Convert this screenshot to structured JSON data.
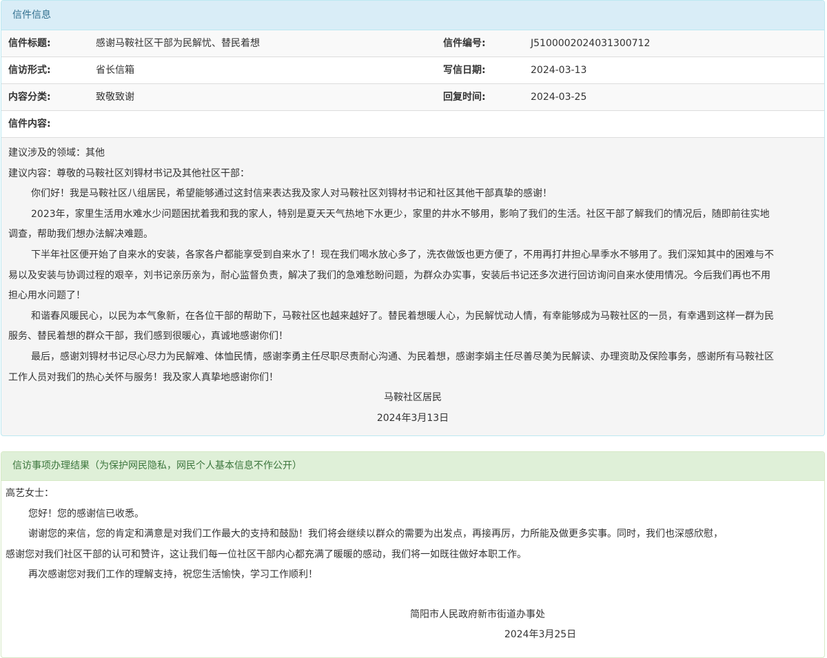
{
  "letter_panel": {
    "title": "信件信息",
    "rows": [
      {
        "label1": "信件标题:",
        "value1": "感谢马鞍社区干部为民解忧、替民着想",
        "label2": "信件编号:",
        "value2": "J5100002024031300712"
      },
      {
        "label1": "信访形式:",
        "value1": "省长信箱",
        "label2": "写信日期:",
        "value2": "2024-03-13"
      },
      {
        "label1": "内容分类:",
        "value1": "致敬致谢",
        "label2": "回复时间:",
        "value2": "2024-03-25"
      }
    ],
    "content_label": "信件内容:",
    "body": {
      "domain": "建议涉及的领域：其他",
      "salutation": "建议内容：尊敬的马鞍社区刘锝材书记及其他社区干部：",
      "lines": [
        {
          "text": "你们好！我是马鞍社区八组居民，希望能够通过这封信来表达我及家人对马鞍社区刘锝材书记和社区其他干部真挚的感谢！",
          "indent": true
        },
        {
          "text": "2023年，家里生活用水难水少问题困扰着我和我的家人，特别是夏天天气热地下水更少，家里的井水不够用，影响了我们的生活。社区干部了解我们的情况后，随即前往实地",
          "indent": true
        },
        {
          "text": "调查，帮助我们想办法解决难题。",
          "indent": false
        },
        {
          "text": "下半年社区便开始了自来水的安装，各家各户都能享受到自来水了！现在我们喝水放心多了，洗衣做饭也更方便了，不用再打井担心旱季水不够用了。我们深知其中的困难与不",
          "indent": true
        },
        {
          "text": "易以及安装与协调过程的艰辛，刘书记亲历亲为，耐心监督负责，解决了我们的急难愁盼问题，为群众办实事，安装后书记还多次进行回访询问自来水使用情况。今后我们再也不用",
          "indent": false
        },
        {
          "text": "担心用水问题了！",
          "indent": false
        },
        {
          "text": "和谐春风暖民心，以民为本气象新，在各位干部的帮助下，马鞍社区也越来越好了。替民着想暖人心，为民解忧动人情，有幸能够成为马鞍社区的一员，有幸遇到这样一群为民",
          "indent": true
        },
        {
          "text": "服务、替民着想的群众干部，我们感到很暖心，真诚地感谢你们！",
          "indent": false
        },
        {
          "text": "最后，感谢刘锝材书记尽心尽力为民解难、体恤民情，感谢李勇主任尽职尽责耐心沟通、为民着想，感谢李娟主任尽善尽美为民解读、办理资助及保险事务，感谢所有马鞍社区",
          "indent": true
        },
        {
          "text": "工作人员对我们的热心关怀与服务！我及家人真挚地感谢你们！",
          "indent": false
        }
      ],
      "signature": "马鞍社区居民",
      "date": "2024年3月13日"
    }
  },
  "reply_panel": {
    "title": "信访事项办理结果（为保护网民隐私，网民个人基本信息不作公开）",
    "salutation": "高艺女士：",
    "lines": [
      {
        "text": "您好！您的感谢信已收悉。",
        "indent": true
      },
      {
        "text": "谢谢您的来信，您的肯定和满意是对我们工作最大的支持和鼓励！我们将会继续以群众的需要为出发点，再接再厉，力所能及做更多实事。同时，我们也深感欣慰，",
        "indent": true
      },
      {
        "text": "感谢您对我们社区干部的认可和赞许，这让我们每一位社区干部内心都充满了暖暖的感动，我们将一如既往做好本职工作。",
        "indent": false
      },
      {
        "text": "再次感谢您对我们工作的理解支持，祝您生活愉快，学习工作顺利！",
        "indent": true
      }
    ],
    "signature": "简阳市人民政府新市街道办事处",
    "date": "2024年3月25日"
  }
}
